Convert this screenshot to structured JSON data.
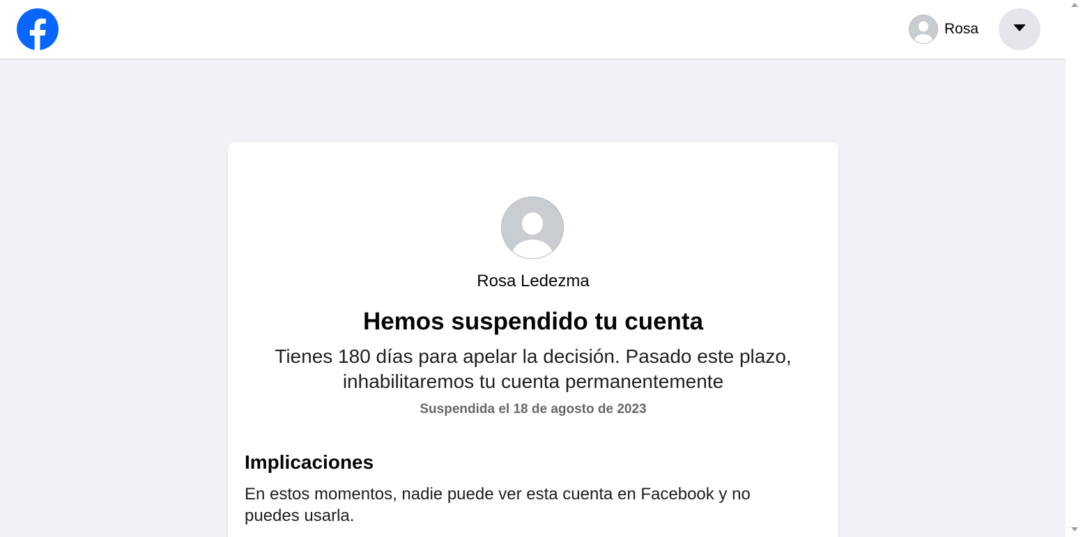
{
  "header": {
    "logo_icon": "facebook-logo-icon",
    "user_name": "Rosa",
    "avatar_icon": "default-avatar-icon",
    "menu_icon": "caret-down-icon"
  },
  "card": {
    "profile_name": "Rosa Ledezma",
    "headline": "Hemos suspendido tu cuenta",
    "subtitle": "Tienes 180 días para apelar la decisión. Pasado este plazo, inhabilitaremos tu cuenta permanentemente",
    "suspended_date": "Suspendida el 18 de agosto de 2023",
    "section": {
      "title": "Implicaciones",
      "body": "En estos momentos, nadie puede ver esta cuenta en Facebook y no puedes usarla."
    }
  },
  "colors": {
    "brand": "#0866ff",
    "background": "#f0f2f5",
    "secondary_text": "#65676b",
    "button_gray": "#e4e6eb"
  }
}
